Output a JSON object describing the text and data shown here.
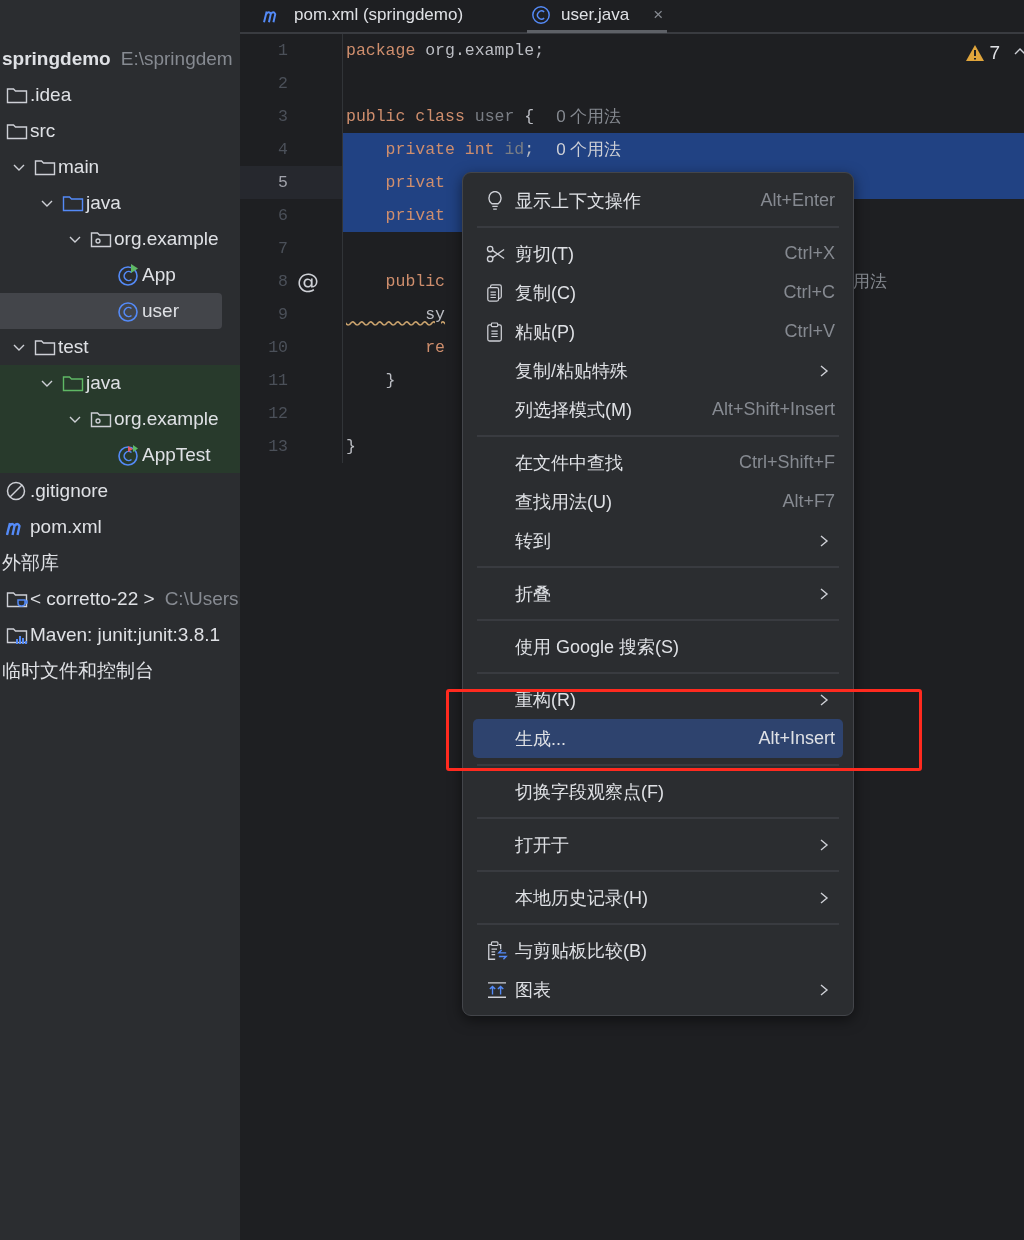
{
  "tabs": [
    {
      "label": "pom.xml (springdemo)",
      "kind": "maven",
      "selected": false
    },
    {
      "label": "user.java",
      "kind": "class",
      "selected": true,
      "close": "×"
    }
  ],
  "project_tree": {
    "items": [
      {
        "label": "springdemo",
        "path": "E:\\springdem",
        "selected": false,
        "test_source": false,
        "children": [
          {
            "label": ".idea",
            "kind": "folder",
            "selected": false,
            "test_source": false
          },
          {
            "label": "src",
            "kind": "folder",
            "selected": false,
            "test_source": false,
            "children": [
              {
                "label": "main",
                "kind": "folder",
                "selected": false,
                "test_source": false,
                "expanded": true,
                "children": [
                  {
                    "label": "java",
                    "kind": "source_folder",
                    "selected": false,
                    "test_source": false,
                    "expanded": true,
                    "children": [
                      {
                        "label": "org.example",
                        "kind": "package",
                        "selected": false,
                        "test_source": false,
                        "expanded": true,
                        "children": [
                          {
                            "label": "App",
                            "kind": "class_main",
                            "selected": false,
                            "test_source": false
                          },
                          {
                            "label": "user",
                            "kind": "class",
                            "selected": true,
                            "test_source": false
                          }
                        ]
                      }
                    ]
                  }
                ]
              },
              {
                "label": "test",
                "kind": "folder",
                "selected": false,
                "test_source": false,
                "expanded": true,
                "children": [
                  {
                    "label": "java",
                    "kind": "test_folder",
                    "selected": false,
                    "test_source": true,
                    "expanded": true,
                    "children": [
                      {
                        "label": "org.example",
                        "kind": "package",
                        "selected": false,
                        "test_source": true,
                        "expanded": true,
                        "children": [
                          {
                            "label": "AppTest",
                            "kind": "test_class",
                            "selected": false,
                            "test_source": true
                          }
                        ]
                      }
                    ]
                  }
                ]
              }
            ]
          },
          {
            "label": ".gitignore",
            "kind": "ignore_file",
            "selected": false,
            "test_source": false
          },
          {
            "label": "pom.xml",
            "kind": "maven_file",
            "selected": false,
            "test_source": false
          }
        ]
      },
      {
        "label": "外部库",
        "selected": false,
        "test_source": false,
        "children": [
          {
            "label": "< corretto-22 >",
            "path": "C:\\Users",
            "kind": "jdk",
            "selected": false,
            "test_source": false
          },
          {
            "label": "Maven: junit:junit:3.8.1",
            "kind": "library",
            "selected": false,
            "test_source": false
          }
        ]
      },
      {
        "label": "临时文件和控制台",
        "selected": false,
        "test_source": false
      }
    ]
  },
  "editor": {
    "warnings": {
      "count": "7"
    },
    "lines": [
      {
        "number": "1",
        "current": false,
        "selected": false,
        "tokens": [
          {
            "kind": "keyword",
            "text": "package"
          },
          {
            "kind": "plain",
            "text": " org.example;"
          }
        ]
      },
      {
        "number": "2",
        "current": false,
        "selected": false
      },
      {
        "number": "3",
        "current": false,
        "selected": false,
        "tokens": [
          {
            "kind": "keyword",
            "text": "public class"
          },
          {
            "kind": "unused",
            "text": " user"
          },
          {
            "kind": "plain",
            "text": " {"
          }
        ],
        "hint": "0 个用法"
      },
      {
        "number": "4",
        "current": false,
        "selected": true,
        "selection_to_edge": true,
        "tokens": [
          {
            "kind": "keyword",
            "text": "    private int"
          },
          {
            "kind": "unused",
            "text": " id"
          },
          {
            "kind": "plain",
            "text": ";"
          }
        ],
        "hint": "0 个用法"
      },
      {
        "number": "5",
        "current": true,
        "selected": true,
        "selection_to_edge": true,
        "tokens": [
          {
            "kind": "keyword",
            "text": "    privat"
          }
        ]
      },
      {
        "number": "6",
        "current": false,
        "selected": true,
        "selection_to_edge": false,
        "tokens": [
          {
            "kind": "keyword",
            "text": "    privat"
          }
        ]
      },
      {
        "number": "7",
        "current": false,
        "selected": false
      },
      {
        "number": "8",
        "current": false,
        "selected": false,
        "gutter_mark": "@",
        "tokens": [
          {
            "kind": "keyword",
            "text": "    public"
          }
        ],
        "hint_after_menu": "用法"
      },
      {
        "number": "9",
        "current": false,
        "selected": false,
        "tokens": [
          {
            "kind": "warning",
            "text": "        sy"
          }
        ]
      },
      {
        "number": "10",
        "current": false,
        "selected": false,
        "tokens": [
          {
            "kind": "keyword",
            "text": "        re"
          }
        ]
      },
      {
        "number": "11",
        "current": false,
        "selected": false,
        "tokens": [
          {
            "kind": "plain",
            "text": "    }"
          }
        ]
      },
      {
        "number": "12",
        "current": false,
        "selected": false
      },
      {
        "number": "13",
        "current": false,
        "selected": false,
        "tokens": [
          {
            "kind": "plain",
            "text": "}"
          }
        ]
      }
    ]
  },
  "context_menu": {
    "items": [
      {
        "kind": "bulb",
        "label": "显示上下文操作",
        "shortcut": "Alt+Enter",
        "submenu": false,
        "selected": false
      },
      {
        "kind": "separator"
      },
      {
        "kind": "scissors",
        "label": "剪切(T)",
        "shortcut": "Ctrl+X",
        "submenu": false,
        "selected": false
      },
      {
        "kind": "copy",
        "label": "复制(C)",
        "shortcut": "Ctrl+C",
        "submenu": false,
        "selected": false
      },
      {
        "kind": "paste",
        "label": "粘贴(P)",
        "shortcut": "Ctrl+V",
        "submenu": false,
        "selected": false
      },
      {
        "kind": "item",
        "label": "复制/粘贴特殊",
        "submenu": true,
        "selected": false
      },
      {
        "kind": "item",
        "label": "列选择模式(M)",
        "shortcut": "Alt+Shift+Insert",
        "submenu": false,
        "selected": false
      },
      {
        "kind": "separator"
      },
      {
        "kind": "item",
        "label": "在文件中查找",
        "shortcut": "Ctrl+Shift+F",
        "submenu": false,
        "selected": false
      },
      {
        "kind": "item",
        "label": "查找用法(U)",
        "shortcut": "Alt+F7",
        "submenu": false,
        "selected": false
      },
      {
        "kind": "item",
        "label": "转到",
        "submenu": true,
        "selected": false
      },
      {
        "kind": "separator"
      },
      {
        "kind": "item",
        "label": "折叠",
        "submenu": true,
        "selected": false
      },
      {
        "kind": "separator"
      },
      {
        "kind": "item",
        "label": "使用 Google 搜索(S)",
        "submenu": false,
        "selected": false
      },
      {
        "kind": "separator"
      },
      {
        "kind": "item",
        "label": "重构(R)",
        "submenu": true,
        "selected": false
      },
      {
        "kind": "item",
        "label": "生成...",
        "shortcut": "Alt+Insert",
        "submenu": false,
        "selected": true
      },
      {
        "kind": "separator"
      },
      {
        "kind": "item",
        "label": "切换字段观察点(F)",
        "submenu": false,
        "selected": false
      },
      {
        "kind": "separator"
      },
      {
        "kind": "item",
        "label": "打开于",
        "submenu": true,
        "selected": false
      },
      {
        "kind": "separator"
      },
      {
        "kind": "item",
        "label": "本地历史记录(H)",
        "submenu": true,
        "selected": false
      },
      {
        "kind": "separator"
      },
      {
        "kind": "compare",
        "label": "与剪贴板比较(B)",
        "submenu": false,
        "selected": false
      },
      {
        "kind": "diagram",
        "label": "图表",
        "submenu": true,
        "selected": false
      }
    ]
  }
}
